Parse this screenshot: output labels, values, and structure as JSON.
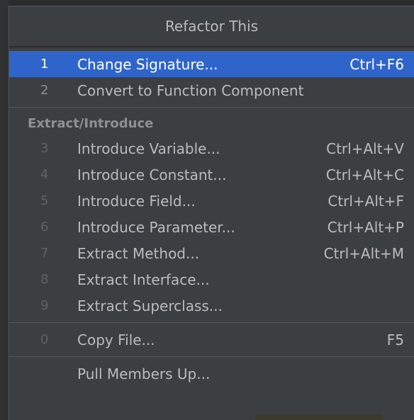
{
  "menu": {
    "title": "Refactor This",
    "items": [
      {
        "num": "1",
        "label": "Change Signature...",
        "shortcut": "Ctrl+F6"
      },
      {
        "num": "2",
        "label": "Convert to Function Component",
        "shortcut": ""
      }
    ],
    "section_header": "Extract/Introduce",
    "extract_items": [
      {
        "num": "3",
        "label": "Introduce Variable...",
        "shortcut": "Ctrl+Alt+V"
      },
      {
        "num": "4",
        "label": "Introduce Constant...",
        "shortcut": "Ctrl+Alt+C"
      },
      {
        "num": "5",
        "label": "Introduce Field...",
        "shortcut": "Ctrl+Alt+F"
      },
      {
        "num": "6",
        "label": "Introduce Parameter...",
        "shortcut": "Ctrl+Alt+P"
      },
      {
        "num": "7",
        "label": "Extract Method...",
        "shortcut": "Ctrl+Alt+M"
      },
      {
        "num": "8",
        "label": "Extract Interface...",
        "shortcut": ""
      },
      {
        "num": "9",
        "label": "Extract Superclass...",
        "shortcut": ""
      }
    ],
    "copy_item": {
      "num": "0",
      "label": "Copy File...",
      "shortcut": "F5"
    },
    "pull_item": {
      "label": "Pull Members Up..."
    }
  },
  "colors": {
    "popup_bg": "#3c3f41",
    "selected_bg": "#2f65ca",
    "text": "#bbbbbb",
    "section_text": "#8d9194"
  }
}
